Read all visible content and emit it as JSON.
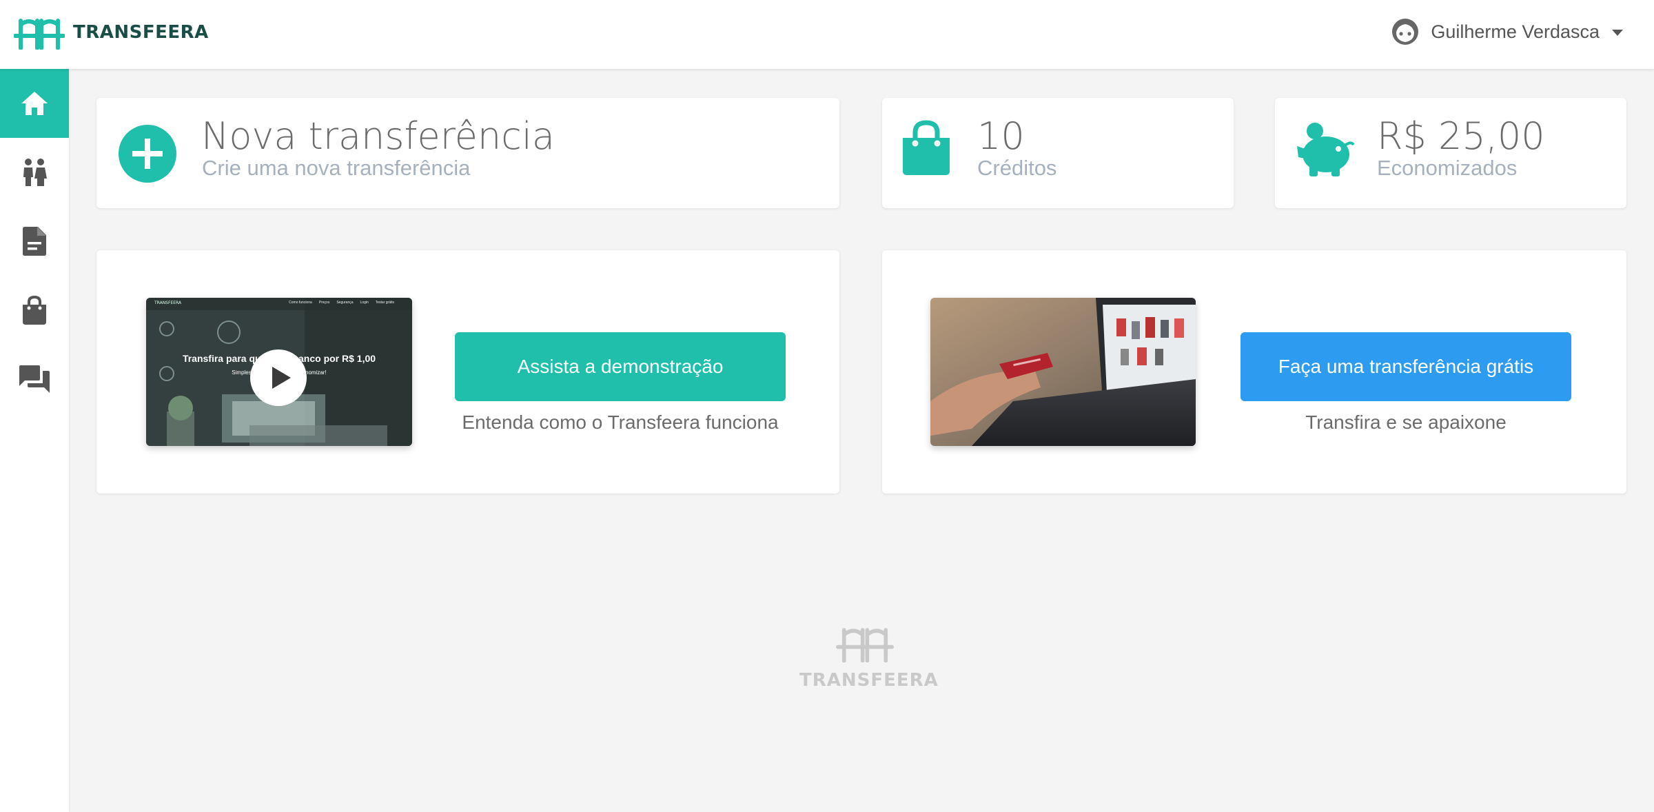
{
  "brand": {
    "name": "TRANSFEERA",
    "accent": "#1fbfab",
    "dark": "#1b4d47"
  },
  "user": {
    "name": "Guilherme Verdasca",
    "icon": "face-icon",
    "menu_icon": "caret-down-icon"
  },
  "sidebar": {
    "items": [
      {
        "icon": "home-icon",
        "active": true
      },
      {
        "icon": "people-icon",
        "active": false
      },
      {
        "icon": "document-icon",
        "active": false
      },
      {
        "icon": "shopping-bag-icon",
        "active": false
      },
      {
        "icon": "chat-icon",
        "active": false
      }
    ]
  },
  "stats": {
    "new_transfer": {
      "title": "Nova transferência",
      "subtitle": "Crie uma nova transferência",
      "icon": "add-circle-icon"
    },
    "credits": {
      "value": "10",
      "label": "Créditos",
      "icon": "shopping-bag-icon"
    },
    "savings": {
      "value": "R$ 25,00",
      "label": "Economizados",
      "icon": "piggy-bank-icon"
    }
  },
  "demo": {
    "button": "Assista a demonstração",
    "caption": "Entenda como o Transfeera funciona",
    "thumb": {
      "headline": "Transfira para qualquer banco por R$ 1,00",
      "sub": "Simples, seguro e fácil de economizar!",
      "nav": [
        "Como funciona",
        "Preços",
        "Segurança",
        "Login",
        "Testar grátis"
      ],
      "mini_brand": "TRANSFEERA"
    }
  },
  "free_transfer": {
    "button": "Faça uma transferência grátis",
    "caption": "Transfira e se apaixone",
    "button_color": "#2d9cf0"
  },
  "footer": {
    "brand": "TRANSFEERA"
  }
}
